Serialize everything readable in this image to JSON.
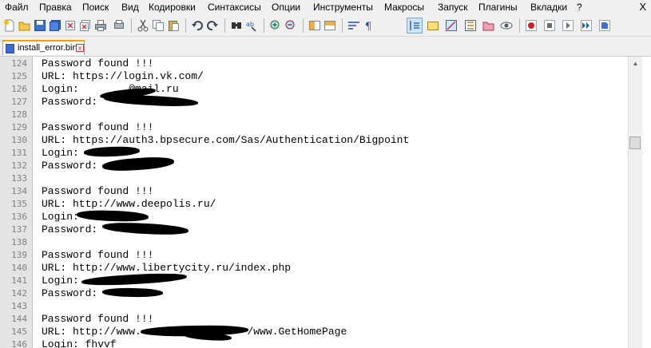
{
  "menu": [
    "Файл",
    "Правка",
    "Поиск",
    "Вид",
    "Кодировки",
    "Синтаксисы",
    "Опции",
    "Инструменты",
    "Макросы",
    "Запуск",
    "Плагины",
    "Вкладки",
    "?"
  ],
  "window_close": "X",
  "tab": {
    "label": "install_error.bin",
    "close": "x"
  },
  "toolbar_icons": [
    "new-file-icon",
    "open-file-icon",
    "save-icon",
    "save-all-icon",
    "close-icon",
    "close-all-icon",
    "print-icon",
    "cut-icon",
    "copy-icon",
    "paste-icon",
    "undo-icon",
    "redo-icon",
    "find-icon",
    "replace-icon",
    "zoom-in-icon",
    "zoom-out-icon",
    "sync-vertical-icon",
    "sync-horizontal-icon",
    "word-wrap-icon",
    "show-all-chars-icon",
    "indent-guide-icon",
    "user-language-icon",
    "doc-map-icon",
    "function-list-icon",
    "folder-workspace-icon",
    "monitoring-icon",
    "record-macro-icon",
    "stop-record-icon",
    "play-macro-icon",
    "play-multiple-icon",
    "save-macro-icon"
  ],
  "lines": [
    {
      "n": "124",
      "t": "Password found !!!"
    },
    {
      "n": "125",
      "t": "URL: https://login.vk.com/"
    },
    {
      "n": "126",
      "t": "Login:        @mail.ru"
    },
    {
      "n": "127",
      "t": "Password:"
    },
    {
      "n": "128",
      "t": ""
    },
    {
      "n": "129",
      "t": "Password found !!!"
    },
    {
      "n": "130",
      "t": "URL: https://auth3.bpsecure.com/Sas/Authentication/Bigpoint"
    },
    {
      "n": "131",
      "t": "Login:"
    },
    {
      "n": "132",
      "t": "Password:"
    },
    {
      "n": "133",
      "t": ""
    },
    {
      "n": "134",
      "t": "Password found !!!"
    },
    {
      "n": "135",
      "t": "URL: http://www.deepolis.ru/"
    },
    {
      "n": "136",
      "t": "Login:"
    },
    {
      "n": "137",
      "t": "Password:"
    },
    {
      "n": "138",
      "t": ""
    },
    {
      "n": "139",
      "t": "Password found !!!"
    },
    {
      "n": "140",
      "t": "URL: http://www.libertycity.ru/index.php"
    },
    {
      "n": "141",
      "t": "Login:"
    },
    {
      "n": "142",
      "t": "Password:"
    },
    {
      "n": "143",
      "t": ""
    },
    {
      "n": "144",
      "t": "Password found !!!"
    },
    {
      "n": "145",
      "t": "URL: http://www.                 /www.GetHomePage"
    },
    {
      "n": "146",
      "t": "Login: fhvvf"
    }
  ]
}
